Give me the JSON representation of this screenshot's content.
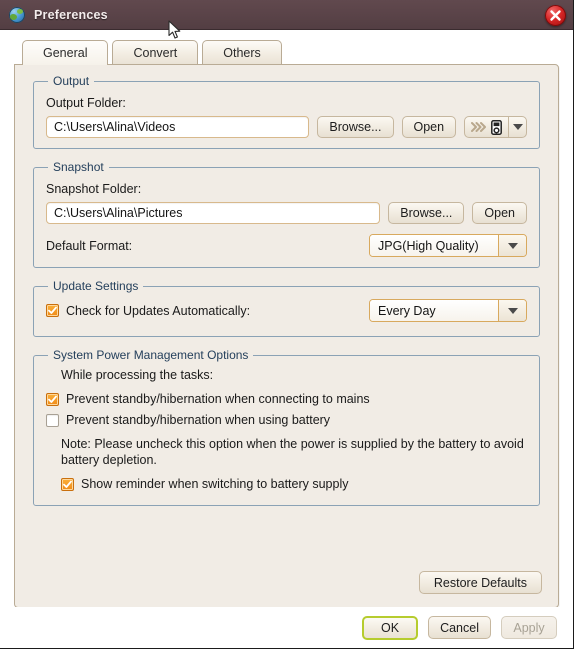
{
  "window": {
    "title": "Preferences",
    "app_icon": "globe-icon",
    "close_label": "close-icon",
    "titlebar_color": "#5b4449",
    "background_color": "#f1ece5",
    "accent_color": "#f08a18",
    "default_button_outline": "#b6cc2e"
  },
  "tabs": [
    {
      "label": "General",
      "active": true
    },
    {
      "label": "Convert",
      "active": false
    },
    {
      "label": "Others",
      "active": false
    }
  ],
  "groups": {
    "output": {
      "title": "Output",
      "folder_label": "Output Folder:",
      "folder_value": "C:\\Users\\Alina\\Videos",
      "browse_label": "Browse...",
      "open_label": "Open",
      "device_button_icon": "device-ipod-icon",
      "device_button_chevrons": "»›",
      "device_dropdown_icon": "chevron-down-icon"
    },
    "snapshot": {
      "title": "Snapshot",
      "folder_label": "Snapshot Folder:",
      "folder_value": "C:\\Users\\Alina\\Pictures",
      "browse_label": "Browse...",
      "open_label": "Open",
      "format_label": "Default Format:",
      "format_value": "JPG(High Quality)"
    },
    "update": {
      "title": "Update Settings",
      "check_updates_label": "Check for Updates Automatically:",
      "check_updates_checked": true,
      "frequency_value": "Every Day"
    },
    "power": {
      "title": "System Power Management Options",
      "intro": "While processing the tasks:",
      "options": [
        {
          "label": "Prevent standby/hibernation when connecting to mains",
          "checked": true
        },
        {
          "label": "Prevent standby/hibernation when using battery",
          "checked": false
        }
      ],
      "note": "Note: Please uncheck this option when the power is supplied by the battery to avoid battery depletion.",
      "reminder": {
        "label": "Show reminder when switching to battery supply",
        "checked": true
      }
    }
  },
  "actions": {
    "restore_defaults": "Restore Defaults",
    "ok": "OK",
    "cancel": "Cancel",
    "apply": "Apply"
  }
}
